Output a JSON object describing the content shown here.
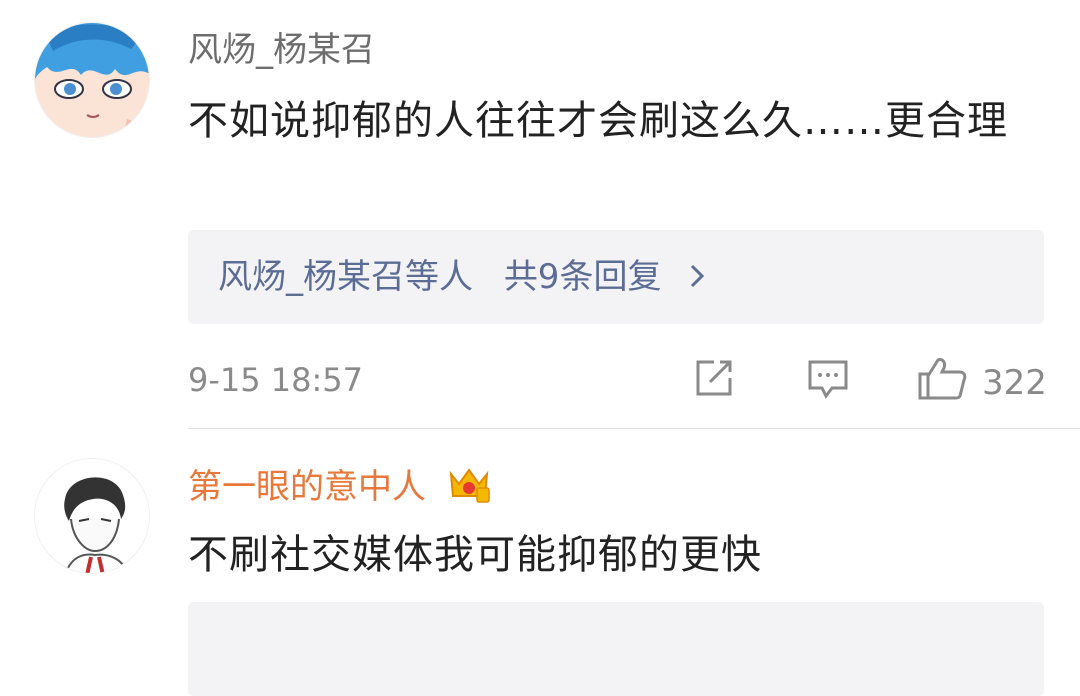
{
  "comments": [
    {
      "username": "风炀_杨某召",
      "text": "不如说抑郁的人往往才会刷这么久……更合理",
      "replies_users": "风炀_杨某召等人",
      "replies_count": "共9条回复",
      "time": "9-15 18:57",
      "likes": "322"
    },
    {
      "username": "第一眼的意中人",
      "text": "不刷社交媒体我可能抑郁的更快"
    }
  ],
  "icons": {
    "share": "share-icon",
    "comment": "comment-icon",
    "like": "thumbs-up-icon",
    "chevron": "chevron-right-icon",
    "vip": "crown-icon"
  },
  "colors": {
    "username_normal": "#6d6d6d",
    "username_vip": "#e8773a",
    "link": "#5b6c95"
  }
}
